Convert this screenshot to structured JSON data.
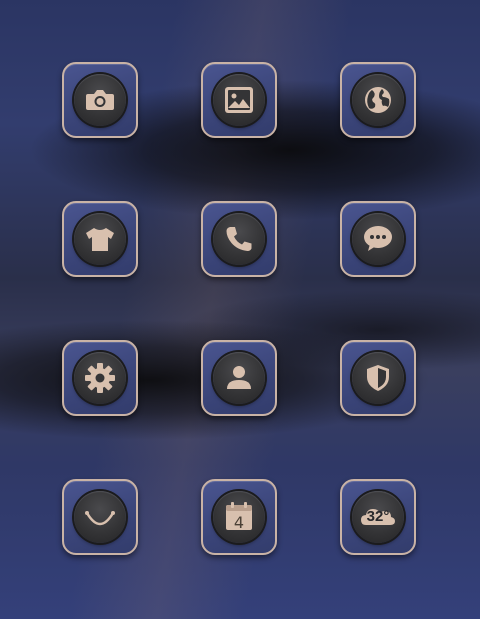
{
  "home_screen": {
    "icons": [
      {
        "id": "camera",
        "icon": "camera-icon"
      },
      {
        "id": "gallery",
        "icon": "image-icon"
      },
      {
        "id": "browser",
        "icon": "globe-icon"
      },
      {
        "id": "themes",
        "icon": "tshirt-icon"
      },
      {
        "id": "phone",
        "icon": "phone-icon"
      },
      {
        "id": "messages",
        "icon": "chat-bubble-icon"
      },
      {
        "id": "settings",
        "icon": "gear-icon"
      },
      {
        "id": "contacts",
        "icon": "person-icon"
      },
      {
        "id": "security",
        "icon": "shield-icon"
      },
      {
        "id": "store",
        "icon": "smile-bag-icon"
      },
      {
        "id": "calendar",
        "icon": "calendar-icon"
      },
      {
        "id": "weather",
        "icon": "cloud-icon"
      }
    ]
  },
  "calendar": {
    "day": "4"
  },
  "weather": {
    "temperature": "32°"
  },
  "colors": {
    "icon_tint": "#d8c0ae",
    "tile_border": "#c9b3a6",
    "tile_fill": "#3f4a82",
    "disc_fill": "#343436"
  }
}
